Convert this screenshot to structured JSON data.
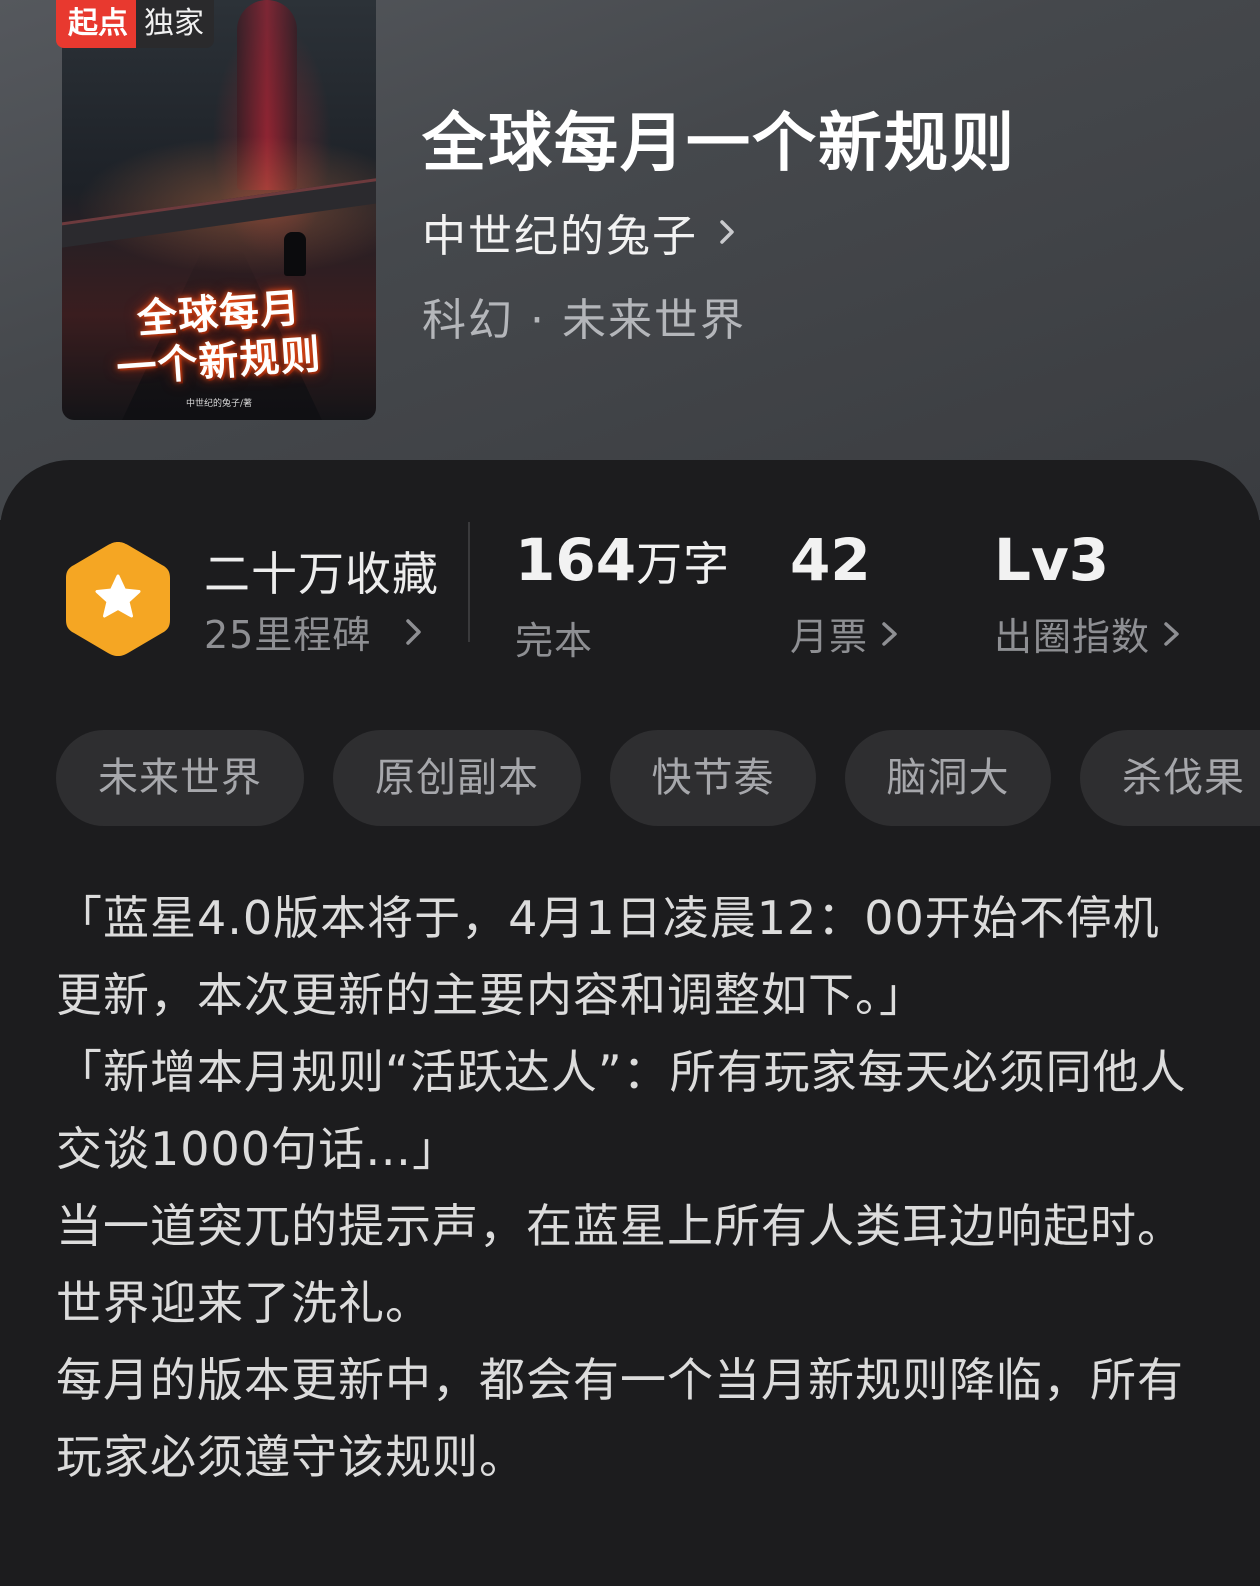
{
  "badge": {
    "brand": "起点",
    "label": "独家"
  },
  "cover": {
    "title_line1": "全球每月",
    "title_line2": "一个新规则",
    "author_credit": "中世纪的兔子/著"
  },
  "book": {
    "title": "全球每月一个新规则",
    "author": "中世纪的兔子",
    "genre": "科幻 · 未来世界"
  },
  "milestone": {
    "title": "二十万收藏",
    "subtitle": "25里程碑",
    "icon": "star-hexagon-icon",
    "icon_color": "#f5a623"
  },
  "stats": {
    "words": {
      "value": "164",
      "unit": "万字",
      "label": "完本"
    },
    "monthly_votes": {
      "value": "42",
      "label": "月票"
    },
    "influence": {
      "value": "Lv3",
      "label": "出圈指数"
    }
  },
  "tags": [
    "未来世界",
    "原创副本",
    "快节奏",
    "脑洞大",
    "杀伐果"
  ],
  "synopsis": [
    "「蓝星4.0版本将于，4月1日凌晨12：00开始不停机更新，本次更新的主要内容和调整如下。」",
    "「新增本月规则“活跃达人”：所有玩家每天必须同他人交谈1000句话…」",
    "当一道突兀的提示声，在蓝星上所有人类耳边响起时。",
    "世界迎来了洗礼。",
    "每月的版本更新中，都会有一个当月新规则降临，所有玩家必须遵守该规则。"
  ],
  "colors": {
    "accent": "#f5a623",
    "badge_red": "#e8392f",
    "background": "#1c1c1e"
  }
}
